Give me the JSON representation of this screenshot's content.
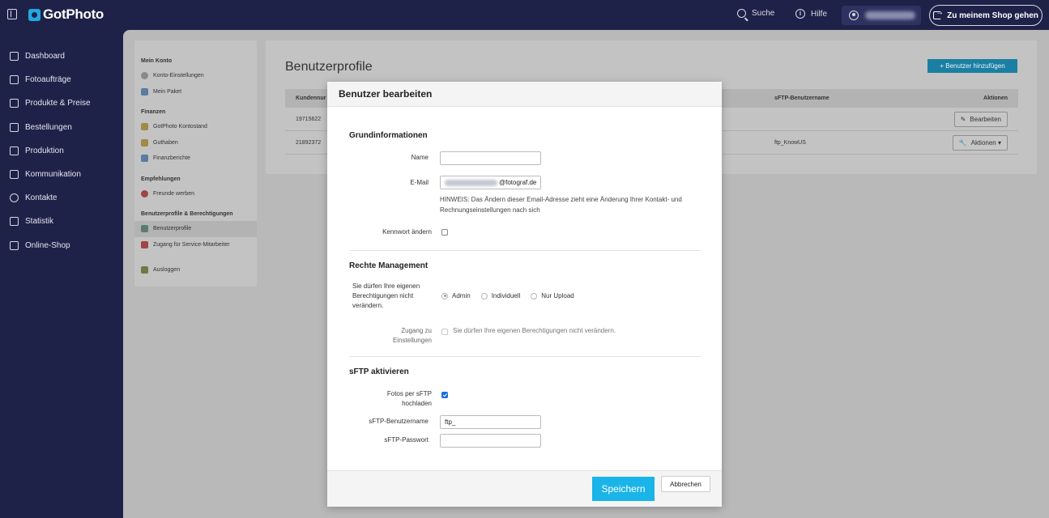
{
  "topbar": {
    "brand": "GotPhoto",
    "search_label": "Suche",
    "help_label": "Hilfe",
    "shop_button": "Zu meinem Shop gehen"
  },
  "nav": {
    "items": [
      {
        "label": "Dashboard",
        "icon": "home-icon"
      },
      {
        "label": "Fotoaufträge",
        "icon": "image-icon"
      },
      {
        "label": "Produkte & Preise",
        "icon": "cart-icon"
      },
      {
        "label": "Bestellungen",
        "icon": "inbox-icon"
      },
      {
        "label": "Produktion",
        "icon": "printer-icon"
      },
      {
        "label": "Kommunikation",
        "icon": "message-icon"
      },
      {
        "label": "Kontakte",
        "icon": "person-icon"
      },
      {
        "label": "Statistik",
        "icon": "chart-icon"
      },
      {
        "label": "Online-Shop",
        "icon": "shop-icon"
      }
    ]
  },
  "subnav": {
    "mein_konto": "Mein Konto",
    "konto_einstellungen": "Konto-Einstellungen",
    "mein_paket": "Mein Paket",
    "finanzen": "Finanzen",
    "kontostand": "GotPhoto Kontostand",
    "guthaben": "Guthaben",
    "finanzberichte": "Finanzberichte",
    "empfehlungen": "Empfehlungen",
    "freunde_werben": "Freunde werben",
    "benutzerprofile_head": "Benutzerprofile & Berechtigungen",
    "benutzerprofile": "Benutzerprofile",
    "service_zugang": "Zugang für Service-Mitarbeiter",
    "ausloggen": "Ausloggen"
  },
  "main": {
    "title": "Benutzerprofile",
    "add_user": "+ Benutzer hinzufügen",
    "columns": {
      "kundennummer": "Kundennur",
      "sftp_user": "sFTP-Benutzername",
      "aktionen": "Aktionen"
    },
    "rows": [
      {
        "id": "19715622",
        "sftp": "",
        "action": "Bearbeiten"
      },
      {
        "id": "21892372",
        "sftp": "ftp_KnowUS",
        "action": "Aktionen ▾"
      }
    ]
  },
  "modal": {
    "title": "Benutzer bearbeiten",
    "grundinfo_title": "Grundinformationen",
    "name_label": "Name",
    "name_value": "",
    "email_label": "E-Mail",
    "email_domain": "@fotograf.de",
    "email_hint": "HINWEIS: Das Ändern dieser Email-Adresse zieht eine Änderung Ihrer Kontakt- und Rechnungseinstellungen nach sich",
    "password_label": "Kennwort ändern",
    "rechte_title": "Rechte Management",
    "rechte_label": "Sie dürfen Ihre eigenen Berechtigungen nicht verändern.",
    "radio_admin": "Admin",
    "radio_individuell": "Individuell",
    "radio_upload": "Nur Upload",
    "zugang_label": "Zugang zu Einstellungen",
    "zugang_text": "Sie dürfen Ihre eigenen Berechtigungen nicht verändern.",
    "sftp_title": "sFTP aktivieren",
    "sftp_upload_label": "Fotos per sFTP hochladen",
    "sftp_user_label": "sFTP-Benutzername",
    "sftp_user_value": "ftp_",
    "sftp_pass_label": "sFTP-Passwort",
    "sftp_pass_value": "",
    "save": "Speichern",
    "cancel": "Abbrechen"
  }
}
